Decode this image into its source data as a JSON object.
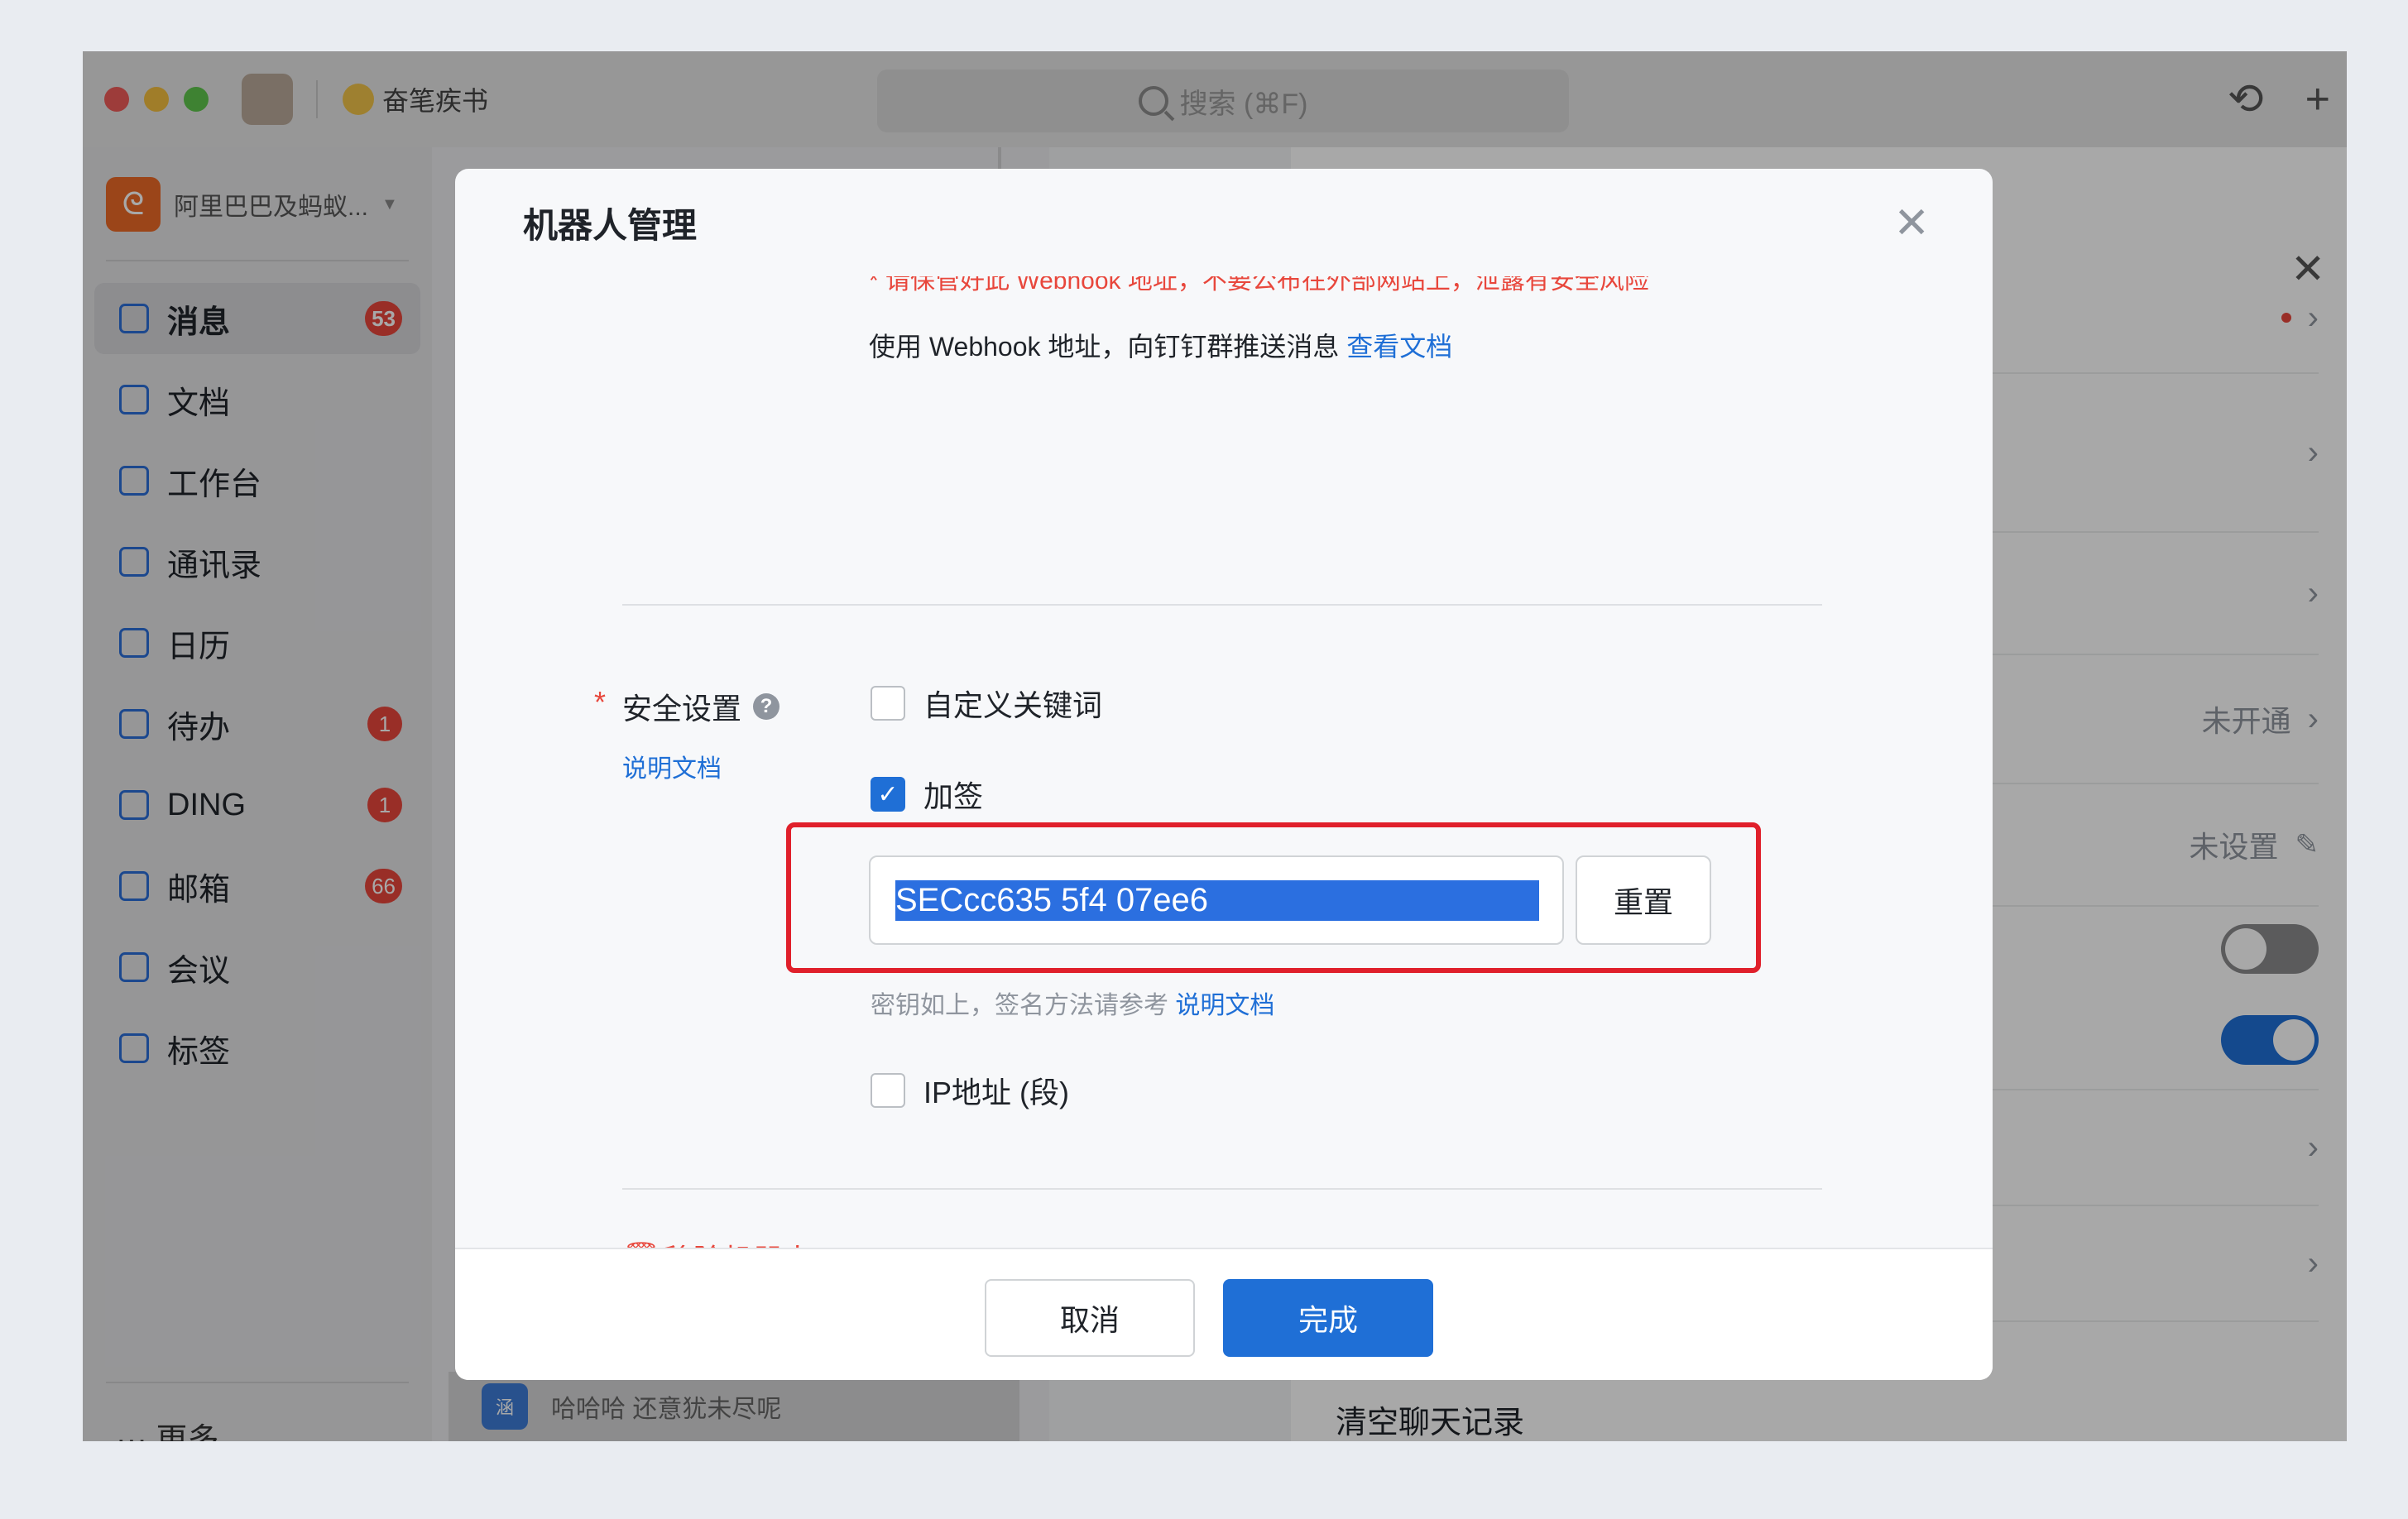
{
  "titlebar": {
    "app_name": "奋笔疾书",
    "search_placeholder": "搜索 (⌘F)"
  },
  "sidebar": {
    "org_name": "阿里巴巴及蚂蚁...",
    "items": [
      {
        "label": "消息",
        "badge": "53",
        "icon": "message-icon"
      },
      {
        "label": "文档",
        "badge": "",
        "icon": "document-icon"
      },
      {
        "label": "工作台",
        "badge": "",
        "icon": "workbench-icon"
      },
      {
        "label": "通讯录",
        "badge": "",
        "icon": "contacts-icon"
      },
      {
        "label": "日历",
        "badge": "",
        "icon": "calendar-icon"
      },
      {
        "label": "待办",
        "badge": "1",
        "icon": "todo-icon"
      },
      {
        "label": "DING",
        "badge": "1",
        "icon": "ding-icon"
      },
      {
        "label": "邮箱",
        "badge": "66",
        "icon": "mail-icon"
      },
      {
        "label": "会议",
        "badge": "",
        "icon": "meeting-icon"
      },
      {
        "label": "标签",
        "badge": "",
        "icon": "tag-icon"
      }
    ],
    "more_label": "··· 更多"
  },
  "chat_list": {
    "bottom_item_avatar": "涵",
    "bottom_item_text": "哈哈哈 还意犹未尽呢"
  },
  "settings_panel": {
    "status_not_enabled": "未开通",
    "status_not_set": "未设置",
    "clear_history": "清空聊天记录"
  },
  "modal": {
    "title": "机器人管理",
    "warning_cut": "* 请保管好此 Webhook 地址，不要公布在外部网站上，泄露有安全风险",
    "webhook_desc": "使用 Webhook 地址，向钉钉群推送消息",
    "webhook_doc_link": "查看文档",
    "security_label": "安全设置",
    "security_doc_link": "说明文档",
    "custom_keyword_label": "自定义关键词",
    "sign_label": "加签",
    "secret_value": "SECcc635                              5f4  07ee6",
    "reset_label": "重置",
    "secret_hint": "密钥如上，签名方法请参考",
    "secret_hint_link": "说明文档",
    "ip_label": "IP地址 (段)",
    "remove_label": "移除机器人",
    "cancel_label": "取消",
    "done_label": "完成"
  },
  "colors": {
    "accent": "#1f6fd6",
    "danger": "#e8473c",
    "highlight_box": "#e0202b"
  }
}
